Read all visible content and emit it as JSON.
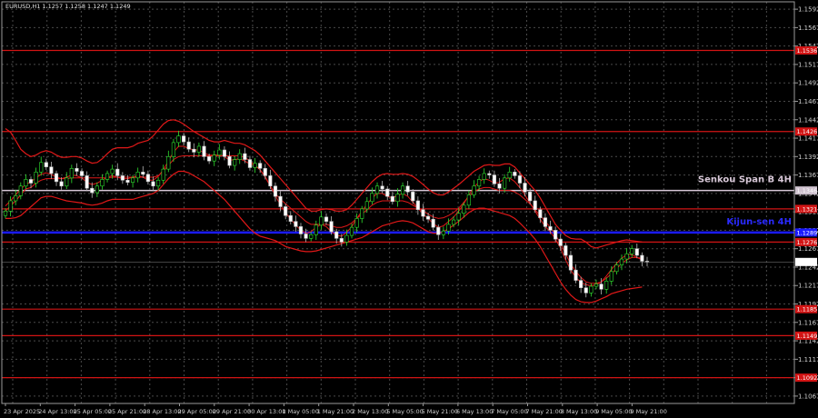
{
  "header": {
    "text": "EURUSD,H1  1.1257 1.1258 1.1247 1.1249"
  },
  "chart_data": {
    "type": "candlestick",
    "symbol": "EURUSD",
    "timeframe": "H1",
    "ohlc_current": {
      "open": 1.1257,
      "high": 1.1258,
      "low": 1.1247,
      "close": 1.1249
    },
    "ylim": [
      1.1057,
      1.1602
    ],
    "y_ticks": [
      1.1592,
      1.1567,
      1.1542,
      1.1517,
      1.1492,
      1.1467,
      1.1442,
      1.1417,
      1.1392,
      1.1367,
      1.1342,
      1.1317,
      1.1292,
      1.1267,
      1.1242,
      1.1217,
      1.1192,
      1.1167,
      1.1142,
      1.1117,
      1.1092,
      1.1067
    ],
    "x_ticks": [
      "23 Apr 2025",
      "24 Apr 13:00",
      "25 Apr 05:00",
      "25 Apr 21:00",
      "28 Apr 13:00",
      "29 Apr 05:00",
      "29 Apr 21:00",
      "30 Apr 13:00",
      "1 May 05:00",
      "1 May 21:00",
      "2 May 13:00",
      "5 May 05:00",
      "5 May 21:00",
      "6 May 13:00",
      "7 May 05:00",
      "7 May 21:00",
      "8 May 13:00",
      "9 May 05:00",
      "9 May 21:00"
    ],
    "levels": [
      {
        "value": 1.1536,
        "color": "#d21414",
        "label": "1.1536"
      },
      {
        "value": 1.1426,
        "color": "#d21414",
        "label": "1.1426"
      },
      {
        "value": 1.1346,
        "color": "#d8c8d8",
        "label": "1.1346",
        "annotation": "Senkou Span B 4H"
      },
      {
        "value": 1.1321,
        "color": "#d21414",
        "label": "1.1321"
      },
      {
        "value": 1.1289,
        "color": "#1a1aff",
        "label": "1.1289",
        "annotation": "Kijun-sen 4H"
      },
      {
        "value": 1.1276,
        "color": "#d21414",
        "label": "1.1276"
      },
      {
        "value": 1.1185,
        "color": "#d21414",
        "label": "1.1185"
      },
      {
        "value": 1.1149,
        "color": "#d21414",
        "label": "1.1149"
      },
      {
        "value": 1.1092,
        "color": "#d21414",
        "label": "1.1092"
      }
    ],
    "price_tag": {
      "value": 1.1249,
      "label": "1.1249"
    },
    "closes": [
      1.1318,
      1.1332,
      1.1339,
      1.1352,
      1.1361,
      1.1356,
      1.1371,
      1.1384,
      1.1378,
      1.1369,
      1.1358,
      1.1352,
      1.1363,
      1.1376,
      1.1372,
      1.1366,
      1.1349,
      1.1343,
      1.1352,
      1.1361,
      1.1369,
      1.1375,
      1.1366,
      1.136,
      1.1357,
      1.1363,
      1.1371,
      1.1368,
      1.1358,
      1.1352,
      1.136,
      1.1375,
      1.1392,
      1.1411,
      1.142,
      1.1412,
      1.1402,
      1.1398,
      1.1406,
      1.1392,
      1.1386,
      1.1394,
      1.1401,
      1.1392,
      1.138,
      1.1388,
      1.1396,
      1.1388,
      1.1377,
      1.1383,
      1.1376,
      1.1366,
      1.1352,
      1.1338,
      1.1324,
      1.1312,
      1.1304,
      1.1297,
      1.1287,
      1.1281,
      1.1286,
      1.1299,
      1.131,
      1.1304,
      1.129,
      1.1281,
      1.1276,
      1.1285,
      1.1296,
      1.1308,
      1.1321,
      1.1331,
      1.1342,
      1.1352,
      1.1348,
      1.1338,
      1.1331,
      1.1341,
      1.1352,
      1.1344,
      1.1332,
      1.132,
      1.1311,
      1.1307,
      1.1296,
      1.1286,
      1.1291,
      1.13,
      1.1306,
      1.1315,
      1.1326,
      1.134,
      1.1352,
      1.1361,
      1.1369,
      1.1367,
      1.1355,
      1.1349,
      1.1363,
      1.1371,
      1.1366,
      1.1356,
      1.1344,
      1.1332,
      1.132,
      1.1309,
      1.1297,
      1.1292,
      1.128,
      1.1271,
      1.1258,
      1.1238,
      1.1224,
      1.1214,
      1.1207,
      1.1216,
      1.1219,
      1.1212,
      1.1223,
      1.1236,
      1.1245,
      1.1253,
      1.126,
      1.1267,
      1.1258,
      1.125,
      1.1249
    ],
    "tenkan": [
      1.1325,
      1.1332,
      1.134,
      1.1348,
      1.1354,
      1.1358,
      1.1363,
      1.1368,
      1.137,
      1.1368,
      1.1364,
      1.1362,
      1.1364,
      1.1367,
      1.1366,
      1.1363,
      1.1357,
      1.1354,
      1.1356,
      1.136,
      1.1364,
      1.1366,
      1.1364,
      1.1362,
      1.1362,
      1.1364,
      1.1366,
      1.1364,
      1.136,
      1.136,
      1.1365,
      1.1374,
      1.1386,
      1.1398,
      1.1406,
      1.1406,
      1.1403,
      1.1401,
      1.1401,
      1.1397,
      1.1394,
      1.1394,
      1.1395,
      1.1392,
      1.1387,
      1.1388,
      1.1389,
      1.1386,
      1.1382,
      1.138,
      1.1374,
      1.1365,
      1.1352,
      1.1339,
      1.1326,
      1.1316,
      1.1307,
      1.1299,
      1.1292,
      1.1288,
      1.129,
      1.1296,
      1.13,
      1.1297,
      1.129,
      1.1285,
      1.1284,
      1.1289,
      1.1297,
      1.1308,
      1.1318,
      1.1327,
      1.1336,
      1.1342,
      1.1342,
      1.1338,
      1.1336,
      1.1339,
      1.1342,
      1.1338,
      1.133,
      1.1322,
      1.1314,
      1.1308,
      1.1301,
      1.1296,
      1.1298,
      1.1304,
      1.131,
      1.1318,
      1.1328,
      1.134,
      1.135,
      1.1358,
      1.1362,
      1.136,
      1.1356,
      1.1357,
      1.1362,
      1.1363,
      1.1358,
      1.135,
      1.134,
      1.1329,
      1.1318,
      1.1307,
      1.1297,
      1.129,
      1.128,
      1.1268,
      1.1252,
      1.1238,
      1.1228,
      1.1221,
      1.1218,
      1.1217,
      1.1218,
      1.1222,
      1.123,
      1.1239,
      1.1247,
      1.1254,
      1.1259,
      1.1259,
      1.1255,
      1.1252
    ],
    "kijun": [
      1.1318,
      1.1325,
      1.1332,
      1.134,
      1.1348,
      1.135,
      1.1356,
      1.136,
      1.1362,
      1.1362,
      1.1362,
      1.1362,
      1.1362,
      1.1363,
      1.1363,
      1.1363,
      1.1363,
      1.1363,
      1.1363,
      1.1363,
      1.1363,
      1.1364,
      1.1364,
      1.1364,
      1.1364,
      1.1364,
      1.1364,
      1.1364,
      1.1364,
      1.1364,
      1.1366,
      1.1372,
      1.138,
      1.1388,
      1.1392,
      1.1393,
      1.1393,
      1.1393,
      1.1393,
      1.1393,
      1.1393,
      1.1393,
      1.1393,
      1.1393,
      1.1393,
      1.1393,
      1.1393,
      1.1391,
      1.1386,
      1.138,
      1.1374,
      1.1364,
      1.1352,
      1.1342,
      1.1334,
      1.1328,
      1.1322,
      1.1316,
      1.131,
      1.1304,
      1.13,
      1.13,
      1.13,
      1.13,
      1.1298,
      1.1296,
      1.1296,
      1.1298,
      1.1302,
      1.1308,
      1.1314,
      1.132,
      1.1326,
      1.133,
      1.1332,
      1.1332,
      1.1332,
      1.1332,
      1.1332,
      1.133,
      1.1326,
      1.1322,
      1.1318,
      1.1314,
      1.131,
      1.1308,
      1.1309,
      1.1312,
      1.1316,
      1.1322,
      1.133,
      1.1338,
      1.1344,
      1.1348,
      1.135,
      1.135,
      1.1348,
      1.1346,
      1.1346,
      1.1346,
      1.1344,
      1.134,
      1.1334,
      1.1328,
      1.132,
      1.1312,
      1.1304,
      1.1296,
      1.1286,
      1.1274,
      1.126,
      1.1246,
      1.1236,
      1.1228,
      1.1222,
      1.122,
      1.122,
      1.1222,
      1.1227,
      1.1233,
      1.124,
      1.1247,
      1.1252,
      1.1255,
      1.1255,
      1.1254
    ],
    "upper_band": [
      1.143,
      1.1425,
      1.1414,
      1.1402,
      1.1396,
      1.1392,
      1.1394,
      1.1398,
      1.14,
      1.1398,
      1.1394,
      1.1391,
      1.1391,
      1.1392,
      1.1392,
      1.139,
      1.1386,
      1.1383,
      1.1384,
      1.1389,
      1.1396,
      1.1402,
      1.1404,
      1.1404,
      1.1404,
      1.1406,
      1.141,
      1.1412,
      1.1414,
      1.142,
      1.1428,
      1.1436,
      1.1441,
      1.1442,
      1.144,
      1.1436,
      1.1431,
      1.1426,
      1.1422,
      1.1418,
      1.1414,
      1.1412,
      1.1412,
      1.1414,
      1.1412,
      1.141,
      1.141,
      1.1408,
      1.1404,
      1.14,
      1.1394,
      1.1386,
      1.1378,
      1.137,
      1.1362,
      1.1354,
      1.1346,
      1.1338,
      1.133,
      1.1322,
      1.1318,
      1.1318,
      1.132,
      1.1321,
      1.132,
      1.1318,
      1.1318,
      1.132,
      1.1326,
      1.1334,
      1.1342,
      1.135,
      1.1358,
      1.1364,
      1.1368,
      1.1369,
      1.1368,
      1.1368,
      1.1369,
      1.1368,
      1.1365,
      1.136,
      1.1354,
      1.1348,
      1.1343,
      1.134,
      1.134,
      1.1344,
      1.1349,
      1.1354,
      1.136,
      1.1366,
      1.1372,
      1.1376,
      1.138,
      1.1381,
      1.138,
      1.138,
      1.1382,
      1.1382,
      1.1378,
      1.137,
      1.1362,
      1.1354,
      1.1346,
      1.1336,
      1.1324,
      1.1312,
      1.13,
      1.1292,
      1.1285,
      1.1281,
      1.128,
      1.128,
      1.1276,
      1.127,
      1.1268,
      1.127,
      1.1272,
      1.1274,
      1.1276,
      1.1278,
      1.1279,
      1.1278,
      1.1277,
      1.1276
    ],
    "lower_band": [
      1.1308,
      1.1308,
      1.1309,
      1.1312,
      1.1318,
      1.1324,
      1.133,
      1.1336,
      1.1338,
      1.1338,
      1.1336,
      1.1334,
      1.1332,
      1.1331,
      1.133,
      1.1329,
      1.1327,
      1.1326,
      1.1327,
      1.1329,
      1.1332,
      1.1334,
      1.1334,
      1.1334,
      1.1334,
      1.1334,
      1.1336,
      1.1338,
      1.134,
      1.1342,
      1.1346,
      1.1354,
      1.1362,
      1.1368,
      1.1372,
      1.1372,
      1.137,
      1.1366,
      1.1362,
      1.1358,
      1.1352,
      1.1346,
      1.134,
      1.1334,
      1.1326,
      1.1318,
      1.131,
      1.1302,
      1.1294,
      1.1288,
      1.1284,
      1.1282,
      1.128,
      1.1278,
      1.1274,
      1.127,
      1.1268,
      1.1266,
      1.1264,
      1.1263,
      1.1263,
      1.1264,
      1.1266,
      1.1268,
      1.127,
      1.1272,
      1.1274,
      1.1276,
      1.1278,
      1.128,
      1.1282,
      1.1286,
      1.129,
      1.1294,
      1.1298,
      1.13,
      1.1302,
      1.1304,
      1.1305,
      1.1304,
      1.1302,
      1.1298,
      1.1294,
      1.129,
      1.1288,
      1.1288,
      1.129,
      1.1294,
      1.1299,
      1.1304,
      1.131,
      1.1316,
      1.132,
      1.1322,
      1.1322,
      1.132,
      1.1318,
      1.1316,
      1.1314,
      1.1312,
      1.1308,
      1.1302,
      1.1295,
      1.1288,
      1.128,
      1.127,
      1.1258,
      1.1246,
      1.1234,
      1.1222,
      1.1212,
      1.1204,
      1.1198,
      1.1195,
      1.1194,
      1.1194,
      1.1196,
      1.1199,
      1.1202,
      1.1206,
      1.1208,
      1.121,
      1.1212,
      1.1213,
      1.1214,
      1.1215
    ]
  }
}
